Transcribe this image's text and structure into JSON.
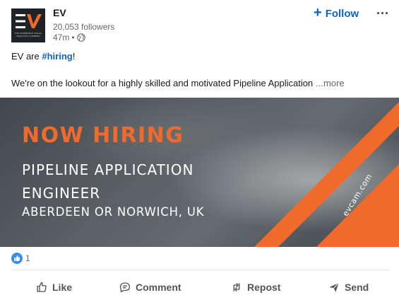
{
  "post": {
    "author": {
      "name": "EV",
      "followers": "20,053 followers",
      "time": "47m",
      "separator": "•",
      "logo_tagline": "THE DOWNHOLE VISUAL ANALYTICS COMPANY",
      "visibility_icon": "globe-icon"
    },
    "follow_label": "Follow",
    "follow_icon": "plus-icon",
    "more_icon": "more-options-icon",
    "text": {
      "prefix": "EV are ",
      "hashtag": "#hiring",
      "suffix": "!",
      "body": "We're on the lookout for a highly skilled and motivated Pipeline Application",
      "more_label": "...more"
    },
    "banner": {
      "headline": "NOW HIRING",
      "role_line1": "PIPELINE APPLICATION",
      "role_line2": "ENGINEER",
      "location": "ABERDEEN OR NORWICH, UK",
      "website": "evcam.com",
      "accent": "#f06a2c"
    },
    "reactions": {
      "count": "1",
      "icon": "like-reaction-icon"
    },
    "actions": [
      {
        "label": "Like",
        "icon": "thumbs-up-icon"
      },
      {
        "label": "Comment",
        "icon": "comment-icon"
      },
      {
        "label": "Repost",
        "icon": "repost-icon"
      },
      {
        "label": "Send",
        "icon": "send-icon"
      }
    ]
  },
  "colors": {
    "brand": "#0a66c2",
    "text": "#191919",
    "muted": "#666666"
  }
}
